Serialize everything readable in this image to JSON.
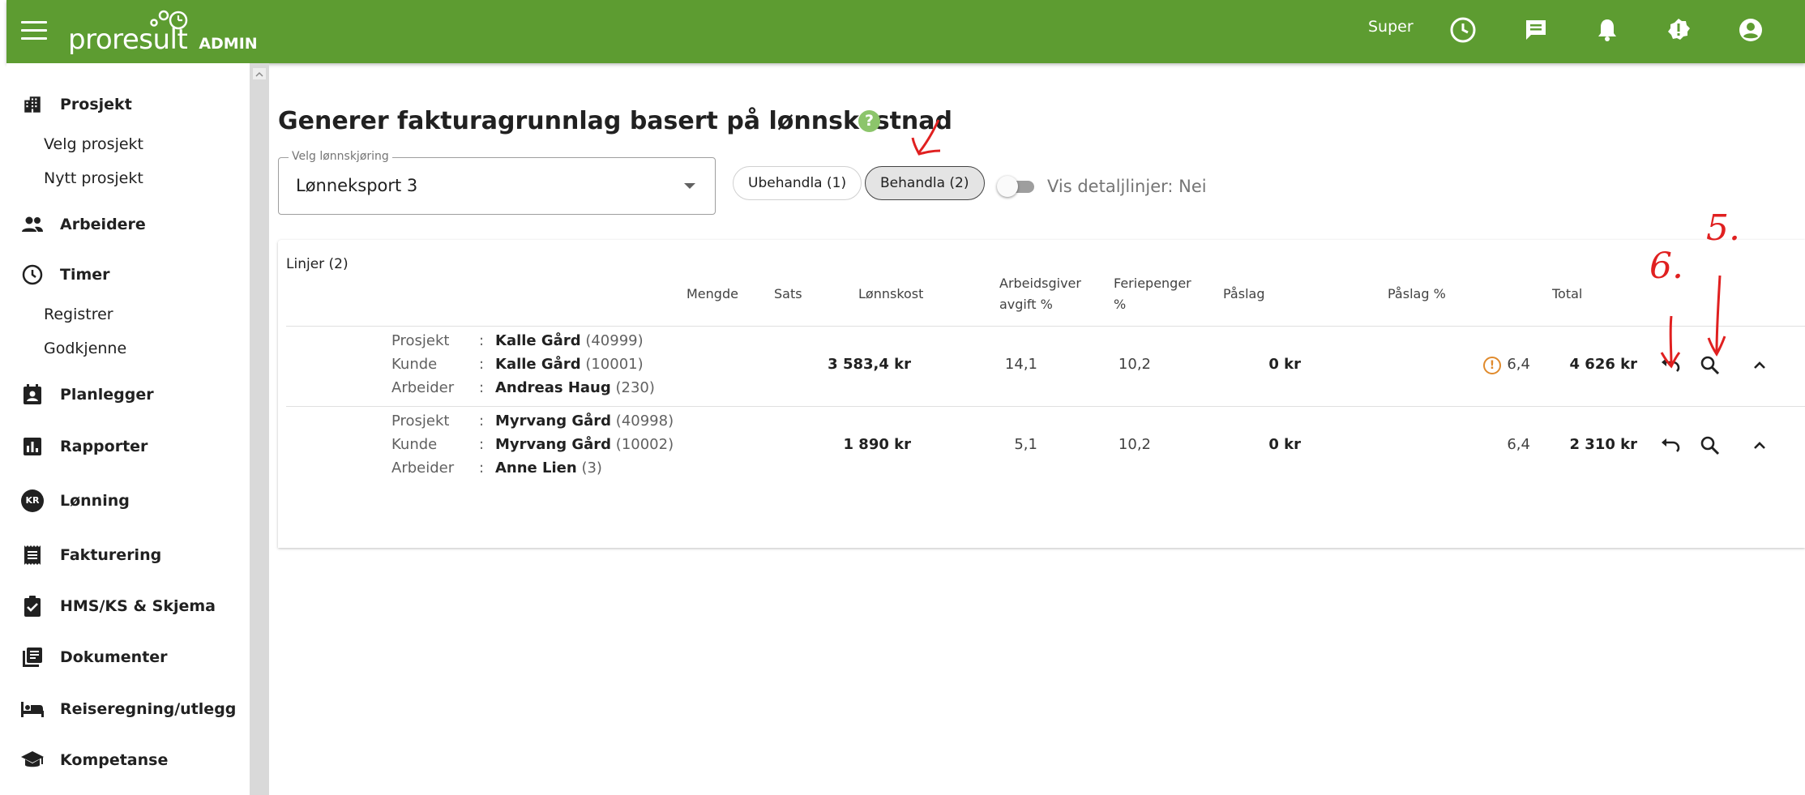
{
  "app": {
    "brand": "proresult",
    "badge": "ADMIN",
    "user": "Super",
    "accent": "#5d9c31"
  },
  "topbar_icons": [
    "clock-icon",
    "chat-icon",
    "bell-icon",
    "alert-badge-icon",
    "account-icon"
  ],
  "sidebar": {
    "items": [
      {
        "label": "Prosjekt",
        "icon": "building-icon"
      },
      {
        "label": "Velg prosjekt"
      },
      {
        "label": "Nytt prosjekt"
      },
      {
        "label": "Arbeidere",
        "icon": "people-icon"
      },
      {
        "label": "Timer",
        "icon": "clock-icon"
      },
      {
        "label": "Registrer"
      },
      {
        "label": "Godkjenne"
      },
      {
        "label": "Planlegger",
        "icon": "contact-calendar-icon"
      },
      {
        "label": "Rapporter",
        "icon": "bar-chart-icon"
      },
      {
        "label": "Lønning",
        "icon": "kr-icon",
        "icon_text": "KR"
      },
      {
        "label": "Fakturering",
        "icon": "receipt-icon"
      },
      {
        "label": "HMS/KS & Skjema",
        "icon": "clipboard-check-icon"
      },
      {
        "label": "Dokumenter",
        "icon": "library-books-icon"
      },
      {
        "label": "Reiseregning/utlegg",
        "icon": "bed-icon"
      },
      {
        "label": "Kompetanse",
        "icon": "school-icon"
      }
    ]
  },
  "main": {
    "title": "Generer fakturagrunnlag basert på lønnskostnad",
    "help": "?",
    "select": {
      "label": "Velg lønnskjøring",
      "value": "Lønneksport 3"
    },
    "chips": [
      {
        "label": "Ubehandla (1)",
        "active": false
      },
      {
        "label": "Behandla (2)",
        "active": true
      }
    ],
    "toggle_label": "Vis detaljlinjer: Nei",
    "toggle_on": false
  },
  "table": {
    "title": "Linjer (2)",
    "headers": {
      "mengde": "Mengde",
      "sats": "Sats",
      "lonnskost": "Lønnskost",
      "arbeidsgiver_1": "Arbeidsgiver",
      "arbeidsgiver_2": "avgift %",
      "feriepenger_1": "Feriepenger",
      "feriepenger_2": "%",
      "paslag": "Påslag",
      "paslag_pct": "Påslag %",
      "total": "Total"
    },
    "labels": {
      "prosjekt": "Prosjekt",
      "kunde": "Kunde",
      "arbeider": "Arbeider",
      "colon": ":"
    },
    "rows": [
      {
        "prosjekt_name": "Kalle Gård",
        "prosjekt_id": "(40999)",
        "kunde_name": "Kalle Gård",
        "kunde_id": "(10001)",
        "arbeider_name": "Andreas Haug",
        "arbeider_id": "(230)",
        "lonnskost": "3 583,4 kr",
        "arbeidsgiveravgift": "14,1",
        "feriepenger": "10,2",
        "paslag": "0 kr",
        "warning": "!",
        "paslag_pct": "6,4",
        "total": "4 626 kr"
      },
      {
        "prosjekt_name": "Myrvang Gård",
        "prosjekt_id": "(40998)",
        "kunde_name": "Myrvang Gård",
        "kunde_id": "(10002)",
        "arbeider_name": "Anne Lien",
        "arbeider_id": "(3)",
        "lonnskost": "1 890 kr",
        "arbeidsgiveravgift": "5,1",
        "feriepenger": "10,2",
        "paslag": "0 kr",
        "paslag_pct": "6,4",
        "total": "2 310 kr"
      }
    ]
  },
  "annotations": {
    "five": "5.",
    "six": "6.",
    "color": "#e02020"
  }
}
